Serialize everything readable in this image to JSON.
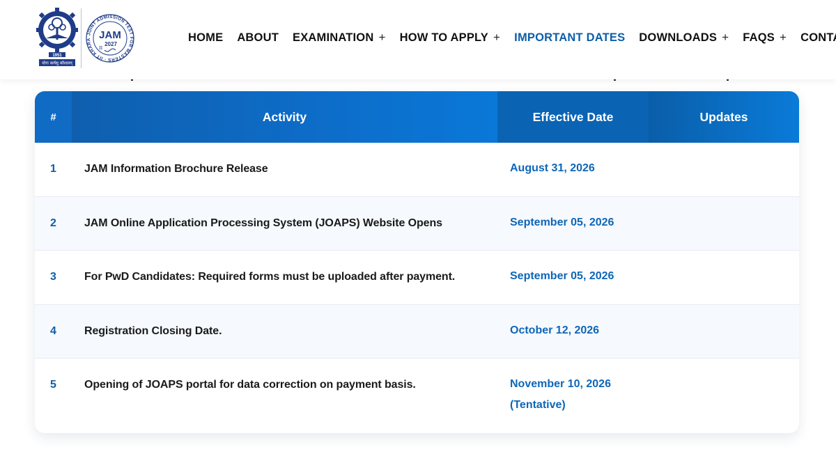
{
  "header": {
    "logo_iit_text": "योगः कर्मसु कौशलम्",
    "logo_iit_year": "1951",
    "logo_jam_text": "JAM",
    "logo_jam_year": "2027",
    "logo_jam_ring": "JOINT ADMISSION TEST FOR MASTERS · IIT KHARAGPUR",
    "nav": [
      {
        "label": "HOME",
        "has_plus": false
      },
      {
        "label": "ABOUT",
        "has_plus": false
      },
      {
        "label": "EXAMINATION",
        "has_plus": true
      },
      {
        "label": "HOW TO APPLY",
        "has_plus": true
      },
      {
        "label": "IMPORTANT DATES",
        "has_plus": false,
        "active": true
      },
      {
        "label": "DOWNLOADS",
        "has_plus": true
      },
      {
        "label": "FAQS",
        "has_plus": true
      },
      {
        "label": "CONTACT",
        "has_plus": false
      }
    ],
    "plus_symbol": "+"
  },
  "table": {
    "columns": [
      "#",
      "Activity",
      "Effective Date",
      "Updates"
    ],
    "rows": [
      {
        "num": "1",
        "activity": "JAM Information Brochure Release",
        "date": "August 31, 2026",
        "note": "",
        "update": ""
      },
      {
        "num": "2",
        "activity": "JAM Online Application Processing System (JOAPS) Website Opens",
        "date": "September 05, 2026",
        "note": "",
        "update": ""
      },
      {
        "num": "3",
        "activity": "For PwD Candidates: Required forms must be uploaded after payment.",
        "date": "September 05, 2026",
        "note": "",
        "update": ""
      },
      {
        "num": "4",
        "activity": "Registration Closing Date.",
        "date": "October 12, 2026",
        "note": "",
        "update": ""
      },
      {
        "num": "5",
        "activity": "Opening of JOAPS portal for data correction on payment basis.",
        "date": "November 10, 2026",
        "note": "(Tentative)",
        "update": ""
      }
    ]
  },
  "colors": {
    "brand_blue": "#0d5ea8",
    "header_blue": "#0f6bc4",
    "date_blue": "#0e66b8",
    "logo_navy": "#1f3c88"
  }
}
